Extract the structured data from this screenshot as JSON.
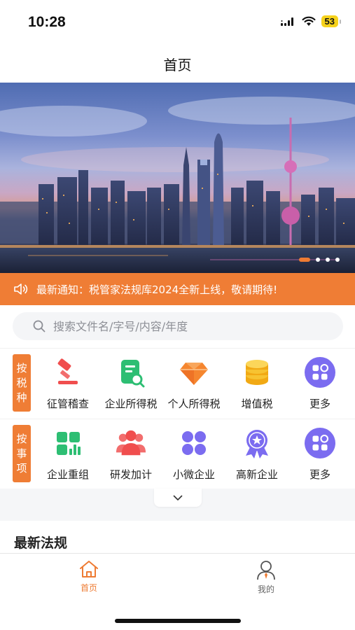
{
  "status_bar": {
    "time": "10:28",
    "battery": "53"
  },
  "nav": {
    "title": "首页"
  },
  "banner": {
    "slide_count": 4,
    "active_slide": 1
  },
  "notice": {
    "text": "最新通知：税管家法规库2024全新上线，敬请期待!"
  },
  "search": {
    "placeholder": "搜索文件名/字号/内容/年度"
  },
  "by_tax": {
    "tag": [
      "按",
      "税",
      "种"
    ],
    "items": [
      {
        "label": "征管稽查",
        "icon": "gavel-icon"
      },
      {
        "label": "企业所得税",
        "icon": "document-search-icon"
      },
      {
        "label": "个人所得税",
        "icon": "diamond-icon"
      },
      {
        "label": "增值税",
        "icon": "coins-icon"
      },
      {
        "label": "更多",
        "icon": "more-grid-icon"
      }
    ]
  },
  "by_matter": {
    "tag": [
      "按",
      "事",
      "项"
    ],
    "items": [
      {
        "label": "企业重组",
        "icon": "grid-chart-icon"
      },
      {
        "label": "研发加计",
        "icon": "people-icon"
      },
      {
        "label": "小微企业",
        "icon": "four-dots-icon"
      },
      {
        "label": "高新企业",
        "icon": "award-badge-icon"
      },
      {
        "label": "更多",
        "icon": "more-grid-icon"
      }
    ]
  },
  "latest": {
    "title": "最新法规"
  },
  "tabbar": {
    "home_label": "首页",
    "mine_label": "我的"
  },
  "colors": {
    "accent": "#EF7D35",
    "purple": "#7B6CF0",
    "green": "#2DBE73",
    "red": "#F04E4E"
  }
}
